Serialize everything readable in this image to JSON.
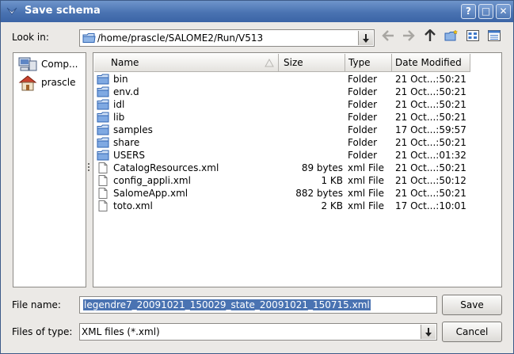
{
  "window": {
    "title": "Save schema",
    "buttons": {
      "help": "?",
      "maximize": "□",
      "close": "✕"
    }
  },
  "look_in": {
    "label": "Look in:",
    "path": "/home/prascle/SALOME2/Run/V513"
  },
  "sidebar": {
    "items": [
      {
        "label": "Comp...",
        "icon": "computer-icon"
      },
      {
        "label": "prascle",
        "icon": "home-icon"
      }
    ]
  },
  "columns": {
    "name": "Name",
    "size": "Size",
    "type": "Type",
    "date": "Date Modified"
  },
  "files": [
    {
      "name": "bin",
      "size": "",
      "type": "Folder",
      "date": "21 Oct...:50:21",
      "kind": "folder"
    },
    {
      "name": "env.d",
      "size": "",
      "type": "Folder",
      "date": "21 Oct...:50:21",
      "kind": "folder"
    },
    {
      "name": "idl",
      "size": "",
      "type": "Folder",
      "date": "21 Oct...:50:21",
      "kind": "folder"
    },
    {
      "name": "lib",
      "size": "",
      "type": "Folder",
      "date": "21 Oct...:50:21",
      "kind": "folder"
    },
    {
      "name": "samples",
      "size": "",
      "type": "Folder",
      "date": "17 Oct...:59:57",
      "kind": "folder"
    },
    {
      "name": "share",
      "size": "",
      "type": "Folder",
      "date": "21 Oct...:50:21",
      "kind": "folder"
    },
    {
      "name": "USERS",
      "size": "",
      "type": "Folder",
      "date": "21 Oct...:01:32",
      "kind": "folder"
    },
    {
      "name": "CatalogResources.xml",
      "size": "89 bytes",
      "type": "xml File",
      "date": "21 Oct...:50:21",
      "kind": "file"
    },
    {
      "name": "config_appli.xml",
      "size": "1 KB",
      "type": "xml File",
      "date": "21 Oct...:50:12",
      "kind": "file"
    },
    {
      "name": "SalomeApp.xml",
      "size": "882 bytes",
      "type": "xml File",
      "date": "21 Oct...:50:21",
      "kind": "file"
    },
    {
      "name": "toto.xml",
      "size": "2 KB",
      "type": "xml File",
      "date": "17 Oct...:10:01",
      "kind": "file"
    }
  ],
  "file_name": {
    "label": "File name:",
    "value": "legendre7_20091021_150029_state_20091021_150715.xml"
  },
  "file_type": {
    "label": "Files of type:",
    "value": "XML files (*.xml)"
  },
  "actions": {
    "save": "Save",
    "cancel": "Cancel"
  },
  "colors": {
    "titlebar": "#4a73b2",
    "selection": "#4a73b2",
    "folder": "#3f78c9"
  }
}
